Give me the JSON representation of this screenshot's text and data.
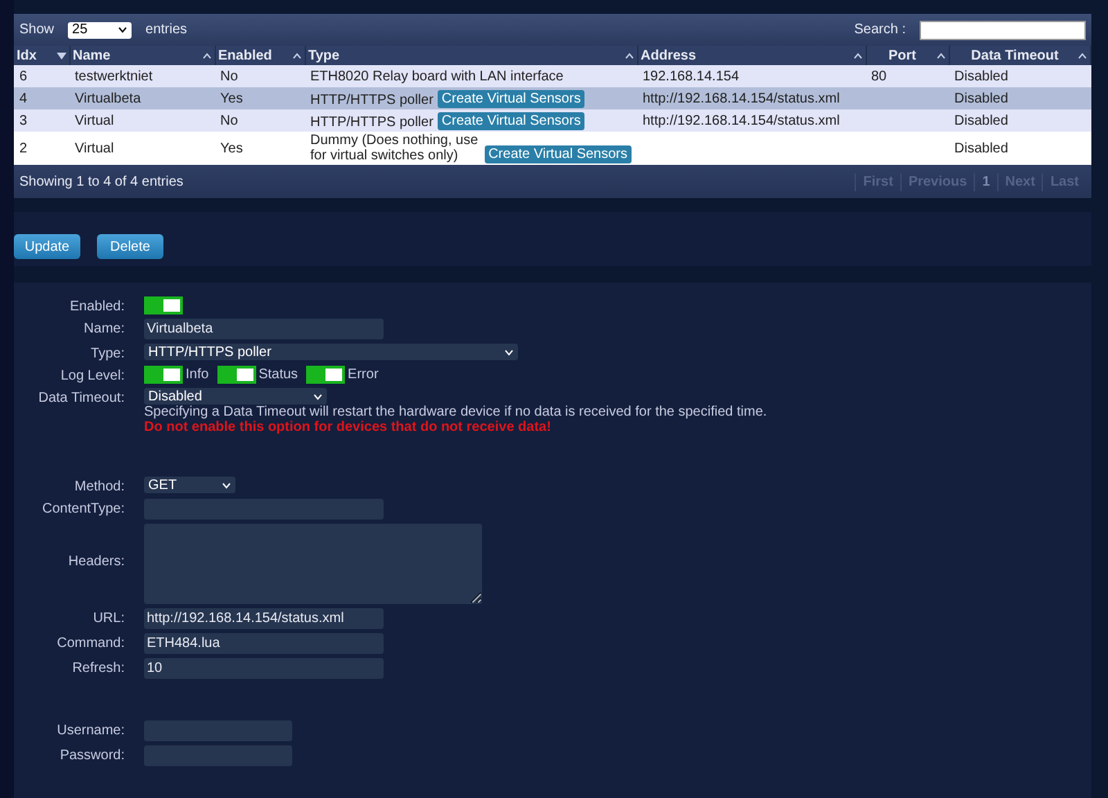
{
  "table": {
    "show_label": "Show",
    "page_size": "25",
    "entries_label": "entries",
    "search_label": "Search :",
    "columns": [
      {
        "label": "Idx",
        "sorted": true
      },
      {
        "label": "Name",
        "sorted": false
      },
      {
        "label": "Enabled",
        "sorted": false
      },
      {
        "label": "Type",
        "sorted": false
      },
      {
        "label": "Address",
        "sorted": false
      },
      {
        "label": "Port",
        "sorted": false
      },
      {
        "label": "Data Timeout",
        "sorted": false
      }
    ],
    "rows": [
      {
        "idx": "6",
        "name": "testwerktniet",
        "enabled": "No",
        "type": "ETH8020 Relay board with LAN interface",
        "address": "192.168.14.154",
        "port": "80",
        "timeout": "Disabled",
        "selected": false
      },
      {
        "idx": "4",
        "name": "Virtualbeta",
        "enabled": "Yes",
        "type": "HTTP/HTTPS poller",
        "action": "Create Virtual Sensors",
        "address": "http://192.168.14.154/status.xml",
        "timeout": "Disabled",
        "selected": true
      },
      {
        "idx": "3",
        "name": "Virtual",
        "enabled": "No",
        "type": "HTTP/HTTPS poller",
        "action": "Create Virtual Sensors",
        "address": "http://192.168.14.154/status.xml",
        "timeout": "Disabled",
        "selected": false
      },
      {
        "idx": "2",
        "name": "Virtual",
        "enabled": "Yes",
        "type": "Dummy (Does nothing, use for virtual switches only)",
        "action": "Create Virtual Sensors",
        "timeout": "Disabled",
        "selected": false
      }
    ],
    "info": "Showing 1 to 4 of 4 entries",
    "pagination": [
      {
        "label": "First",
        "selected": false
      },
      {
        "label": "Previous",
        "selected": false
      },
      {
        "label": "1",
        "selected": true
      },
      {
        "label": "Next",
        "selected": false
      },
      {
        "label": "Last",
        "selected": false
      }
    ]
  },
  "buttons": [
    "Update",
    "Delete"
  ],
  "form": {
    "sections": [
      [
        {
          "kind": "toggle",
          "label": "Enabled:",
          "on": true
        },
        {
          "kind": "input",
          "label": "Name:",
          "value": "Virtualbeta"
        },
        {
          "kind": "select",
          "label": "Type:",
          "value": "HTTP/HTTPS poller"
        },
        {
          "kind": "toggles",
          "label": "Log Level:",
          "options": [
            {
              "label": "Info",
              "on": true
            },
            {
              "label": "Status",
              "on": true
            },
            {
              "label": "Error",
              "on": true
            }
          ]
        },
        {
          "kind": "select",
          "label": "Data Timeout:",
          "value": "Disabled",
          "help": "Specifying a Data Timeout will restart the hardware device if no data is received for the specified time.",
          "warning": "Do not enable this option for devices that do not receive data!"
        }
      ],
      [
        {
          "kind": "select",
          "label": "Method:",
          "value": "GET"
        },
        {
          "kind": "input",
          "label": "ContentType:"
        },
        {
          "kind": "textarea",
          "label": "Headers:"
        },
        {
          "kind": "input",
          "label": "URL:",
          "value": "http://192.168.14.154/status.xml"
        },
        {
          "kind": "input",
          "label": "Command:",
          "value": "ETH484.lua"
        },
        {
          "kind": "input",
          "label": "Refresh:",
          "value": "10"
        }
      ],
      [
        {
          "kind": "input",
          "label": "Username:"
        },
        {
          "kind": "input",
          "label": "Password:"
        }
      ]
    ]
  }
}
